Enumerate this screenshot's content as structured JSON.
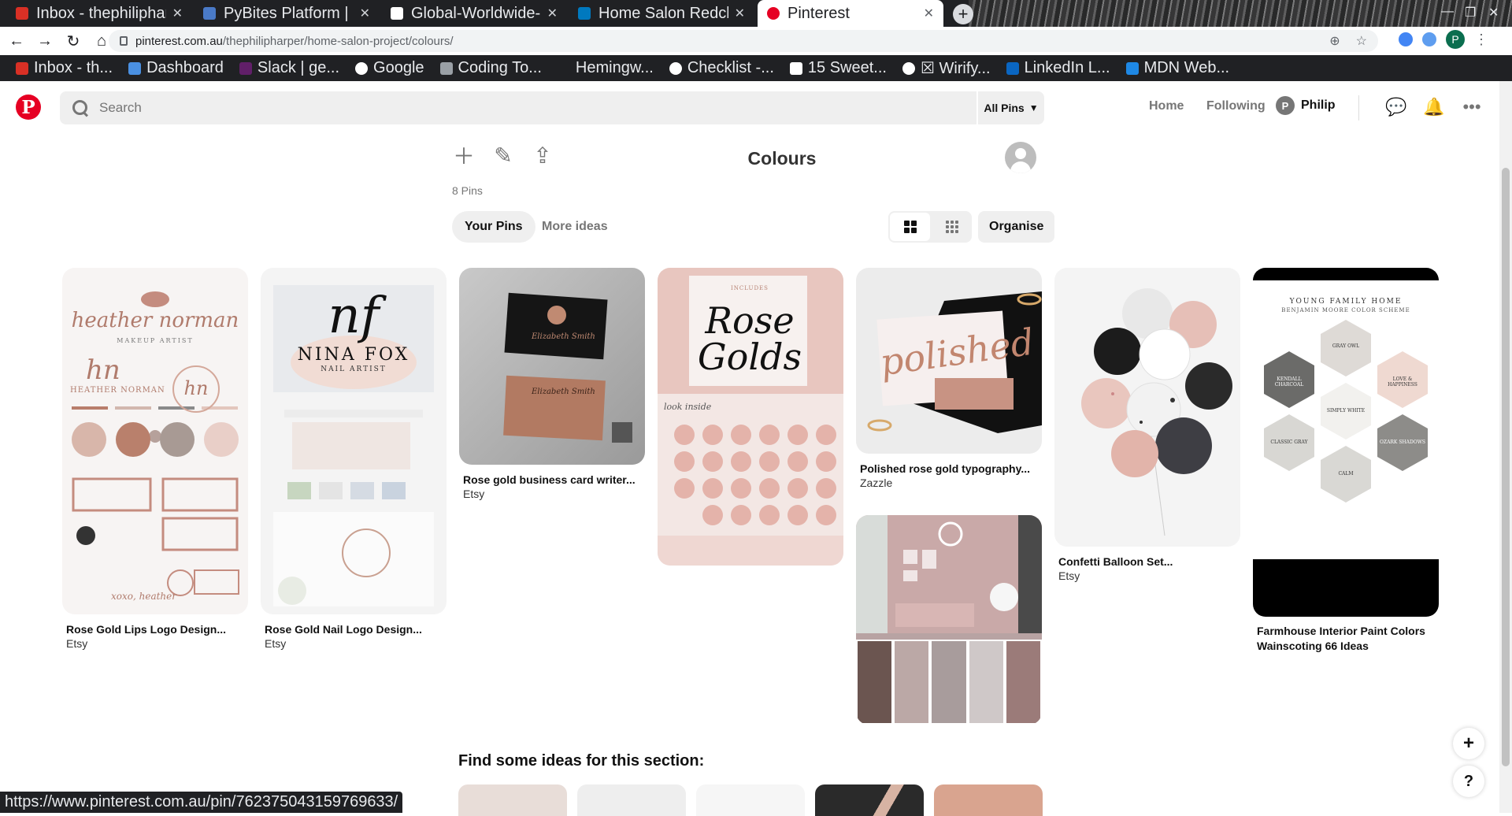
{
  "browser": {
    "tabs": [
      {
        "title": "Inbox - thephiliphar",
        "favicon_color": "#d93025"
      },
      {
        "title": "PyBites Platform | ",
        "favicon_color": "#4a7ac7"
      },
      {
        "title": "Global-Worldwide-",
        "favicon_color": "#ffffff"
      },
      {
        "title": "Home Salon Redcli",
        "favicon_color": "#0079bf"
      },
      {
        "title": "Pinterest",
        "favicon_color": "#e60023"
      }
    ],
    "url_domain": "pinterest.com.au",
    "url_path": "/thephilipharper/home-salon-project/colours/",
    "profile_initial": "P",
    "bookmarks": [
      {
        "label": "Inbox - th...",
        "icon_color": "#d93025"
      },
      {
        "label": "Dashboard",
        "icon_color": "#4a90e2"
      },
      {
        "label": "Slack | ge...",
        "icon_color": "#611f69"
      },
      {
        "label": "Google",
        "icon_color": "#ffffff"
      },
      {
        "label": "Coding To...",
        "icon_color": "#9aa0a6"
      },
      {
        "label": "Hemingw...",
        "icon_color": "#202124"
      },
      {
        "label": "Checklist -...",
        "icon_color": "#ffffff"
      },
      {
        "label": "15 Sweet...",
        "icon_color": "#ffffff"
      },
      {
        "label": "☒ Wirify...",
        "icon_color": "#ffffff"
      },
      {
        "label": "LinkedIn L...",
        "icon_color": "#0a66c2"
      },
      {
        "label": "MDN Web...",
        "icon_color": "#1e88e5"
      }
    ],
    "status_url": "https://www.pinterest.com.au/pin/762375043159769633/"
  },
  "header": {
    "logo": "P",
    "search_placeholder": "Search",
    "filter_label": "All Pins",
    "nav_home": "Home",
    "nav_following": "Following",
    "user_initial": "P",
    "user_name": "Philip",
    "brand_color": "#e60023"
  },
  "board": {
    "ghost_title": "Colours",
    "title": "Colours",
    "pin_count": "8 Pins",
    "tab_your_pins": "Your Pins",
    "tab_more_ideas": "More ideas",
    "organise_label": "Organise"
  },
  "pins": [
    {
      "title": "Rose Gold Lips Logo Design...",
      "source": "Etsy",
      "img": {
        "brand": "heather norman",
        "sub": "MAKEUP ARTIST",
        "mono": "hn",
        "name": "HEATHER NORMAN",
        "sign": "xoxo, heather"
      }
    },
    {
      "title": "Rose Gold Nail Logo Design...",
      "source": "Etsy",
      "img": {
        "mono": "nf",
        "brand": "NINA FOX",
        "sub": "NAIL ARTIST"
      }
    },
    {
      "title": "Rose gold business card writer...",
      "source": "Etsy",
      "img": {
        "card_name": "Elizabeth Smith"
      }
    },
    {
      "title": "",
      "source": "",
      "img": {
        "headline": "Rose Golds",
        "top": "INCLUDES",
        "inside": "look inside"
      }
    },
    {
      "title": "Polished rose gold typography...",
      "source": "Zazzle",
      "img": {
        "word": "polished"
      }
    },
    {
      "title": "",
      "source": "",
      "img": {
        "swatches": [
          "#6b5550",
          "#bba8a6",
          "#a89c9c",
          "#cfc8c8",
          "#9b7b79"
        ]
      }
    },
    {
      "title": "Confetti Balloon Set...",
      "source": "Etsy",
      "img": {}
    },
    {
      "title": "Farmhouse Interior Paint Colors Wainscoting 66 Ideas",
      "source": "",
      "img": {
        "heading": "YOUNG FAMILY HOME",
        "subheading": "BENJAMIN MOORE COLOR SCHEME",
        "hexes": [
          "GRAY OWL",
          "KENDALL CHARCOAL",
          "LOVE & HAPPINESS",
          "SIMPLY WHITE",
          "CLASSIC GRAY",
          "OZARK SHADOWS",
          "CALM"
        ]
      }
    }
  ],
  "find_ideas": {
    "title": "Find some ideas for this section:",
    "thumb_colors": [
      "#e8ddd8",
      "#eeeeee",
      "#f6f6f6",
      "#2a2a2a",
      "#d9a48f"
    ]
  },
  "fabs": {
    "plus": "+",
    "help": "?"
  }
}
